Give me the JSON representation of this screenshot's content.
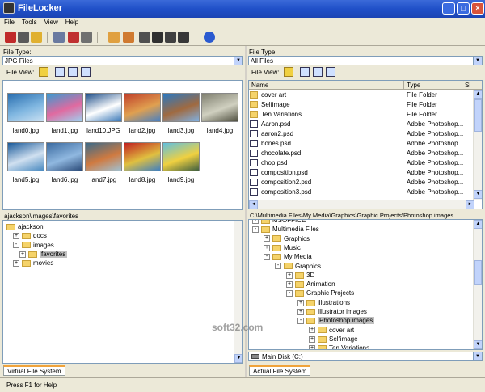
{
  "window": {
    "title": "FileLocker"
  },
  "menu": [
    "File",
    "Tools",
    "View",
    "Help"
  ],
  "left": {
    "file_type_label": "File Type:",
    "file_type_value": "JPG Files",
    "file_view_label": "File View:",
    "thumbnails": [
      {
        "name": "land0.jpg",
        "colors": [
          "#2a6fb0",
          "#7fb6e0",
          "#c9e0f2"
        ]
      },
      {
        "name": "land1.jpg",
        "colors": [
          "#3a9ad0",
          "#e06aa0",
          "#9fd0f0"
        ]
      },
      {
        "name": "land10.JPG",
        "colors": [
          "#1f4f8a",
          "#ffffff",
          "#3a78b8"
        ]
      },
      {
        "name": "land2.jpg",
        "colors": [
          "#c0402a",
          "#e0a050",
          "#4a80c0"
        ]
      },
      {
        "name": "land3.jpg",
        "colors": [
          "#2a78c0",
          "#a06a40",
          "#80b0e0"
        ]
      },
      {
        "name": "land4.jpg",
        "colors": [
          "#808070",
          "#d0d0c0",
          "#505040"
        ]
      },
      {
        "name": "land5.jpg",
        "colors": [
          "#1a5a9a",
          "#d0e0f0",
          "#4a8ac0"
        ]
      },
      {
        "name": "land6.jpg",
        "colors": [
          "#3a6aa0",
          "#90b8e0",
          "#2a4a78"
        ]
      },
      {
        "name": "land7.jpg",
        "colors": [
          "#3a6a8a",
          "#d07a40",
          "#a0c0d0"
        ]
      },
      {
        "name": "land8.jpg",
        "colors": [
          "#c02020",
          "#e0c040",
          "#4080c0"
        ]
      },
      {
        "name": "land9.jpg",
        "colors": [
          "#60c0e0",
          "#f0d040",
          "#406040"
        ]
      }
    ],
    "path": "ajackson\\images\\favorites",
    "tree": [
      {
        "label": "ajackson",
        "depth": 0,
        "pm": "",
        "selected": false
      },
      {
        "label": "docs",
        "depth": 1,
        "pm": "+",
        "selected": false
      },
      {
        "label": "images",
        "depth": 1,
        "pm": "−",
        "selected": false
      },
      {
        "label": "favorites",
        "depth": 2,
        "pm": "+",
        "selected": true
      },
      {
        "label": "movies",
        "depth": 1,
        "pm": "+",
        "selected": false
      }
    ],
    "tab": "Virtual File System"
  },
  "right": {
    "file_type_label": "File Type:",
    "file_type_value": "All Files",
    "file_view_label": "File View:",
    "columns": [
      "Name",
      "Type",
      "Si"
    ],
    "files": [
      {
        "name": "cover art",
        "type": "File Folder",
        "icon": "folder"
      },
      {
        "name": "Selfimage",
        "type": "File Folder",
        "icon": "folder"
      },
      {
        "name": "Ten Variations",
        "type": "File Folder",
        "icon": "folder"
      },
      {
        "name": "Aaron.psd",
        "type": "Adobe Photoshop...",
        "icon": "psd"
      },
      {
        "name": "aaron2.psd",
        "type": "Adobe Photoshop...",
        "icon": "psd"
      },
      {
        "name": "bones.psd",
        "type": "Adobe Photoshop...",
        "icon": "psd"
      },
      {
        "name": "chocolate.psd",
        "type": "Adobe Photoshop...",
        "icon": "psd"
      },
      {
        "name": "chop.psd",
        "type": "Adobe Photoshop...",
        "icon": "psd"
      },
      {
        "name": "composition.psd",
        "type": "Adobe Photoshop...",
        "icon": "psd"
      },
      {
        "name": "composition2.psd",
        "type": "Adobe Photoshop...",
        "icon": "psd"
      },
      {
        "name": "composition3.psd",
        "type": "Adobe Photoshop...",
        "icon": "psd"
      }
    ],
    "path": "C:\\Multimedia Files\\My Media\\Graphics\\Graphic Projects\\Photoshop images",
    "tree": [
      {
        "label": "MSOFFICE",
        "depth": 0,
        "pm": "+",
        "selected": false
      },
      {
        "label": "Multimedia Files",
        "depth": 0,
        "pm": "−",
        "selected": false
      },
      {
        "label": "Graphics",
        "depth": 1,
        "pm": "+",
        "selected": false
      },
      {
        "label": "Music",
        "depth": 1,
        "pm": "+",
        "selected": false
      },
      {
        "label": "My Media",
        "depth": 1,
        "pm": "−",
        "selected": false
      },
      {
        "label": "Graphics",
        "depth": 2,
        "pm": "−",
        "selected": false
      },
      {
        "label": "3D",
        "depth": 3,
        "pm": "+",
        "selected": false
      },
      {
        "label": "Animation",
        "depth": 3,
        "pm": "+",
        "selected": false
      },
      {
        "label": "Graphic Projects",
        "depth": 3,
        "pm": "−",
        "selected": false
      },
      {
        "label": "illustrations",
        "depth": 4,
        "pm": "+",
        "selected": false
      },
      {
        "label": "Illustrator images",
        "depth": 4,
        "pm": "+",
        "selected": false
      },
      {
        "label": "Photoshop images",
        "depth": 4,
        "pm": "−",
        "selected": true
      },
      {
        "label": "cover art",
        "depth": 5,
        "pm": "+",
        "selected": false
      },
      {
        "label": "Selfimage",
        "depth": 5,
        "pm": "+",
        "selected": false
      },
      {
        "label": "Ten Variations",
        "depth": 5,
        "pm": "+",
        "selected": false
      }
    ],
    "disk": "Main Disk (C:)",
    "tab": "Actual File System"
  },
  "status": "Press F1 for Help",
  "watermark": "soft32.com"
}
